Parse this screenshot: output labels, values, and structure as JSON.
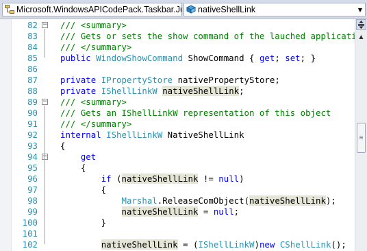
{
  "navbar": {
    "type_combo": {
      "label": "Microsoft.WindowsAPICodePack.Taskbar.Ju",
      "icon": "class-icon"
    },
    "member_combo": {
      "label": "nativeShellLink",
      "icon": "field-icon"
    }
  },
  "colors": {
    "keyword": "#0000ff",
    "comment": "#008000",
    "type": "#2b91af",
    "line_number": "#2b91af",
    "reference_highlight": "#e5e5d6"
  },
  "lines": [
    {
      "num": "82",
      "fold": "-",
      "segs": [
        {
          "t": "/// <summary>",
          "c": "c"
        }
      ]
    },
    {
      "num": "83",
      "segs": [
        {
          "t": "/// Gets or sets the show command of the lauched application.",
          "c": "c"
        }
      ]
    },
    {
      "num": "84",
      "segs": [
        {
          "t": "/// </summary>",
          "c": "c"
        }
      ]
    },
    {
      "num": "85",
      "segs": [
        {
          "t": "public ",
          "c": "k"
        },
        {
          "t": "WindowShowCommand",
          "c": "t"
        },
        {
          "t": " ShowCommand { "
        },
        {
          "t": "get",
          "c": "k"
        },
        {
          "t": "; "
        },
        {
          "t": "set",
          "c": "k"
        },
        {
          "t": "; }"
        }
      ]
    },
    {
      "num": "86",
      "segs": []
    },
    {
      "num": "87",
      "segs": [
        {
          "t": "private ",
          "c": "k"
        },
        {
          "t": "IPropertyStore",
          "c": "t"
        },
        {
          "t": " nativePropertyStore;"
        }
      ]
    },
    {
      "num": "88",
      "segs": [
        {
          "t": "private ",
          "c": "k"
        },
        {
          "t": "IShellLinkW",
          "c": "t"
        },
        {
          "t": " "
        },
        {
          "t": "nativeShellLink",
          "h": true
        },
        {
          "t": ";"
        }
      ]
    },
    {
      "num": "89",
      "fold": "-",
      "segs": [
        {
          "t": "/// <summary>",
          "c": "c"
        }
      ]
    },
    {
      "num": "90",
      "segs": [
        {
          "t": "/// Gets an IShellLinkW representation of this object",
          "c": "c"
        }
      ]
    },
    {
      "num": "91",
      "segs": [
        {
          "t": "/// </summary>",
          "c": "c"
        }
      ]
    },
    {
      "num": "92",
      "segs": [
        {
          "t": "internal ",
          "c": "k"
        },
        {
          "t": "IShellLinkW",
          "c": "t"
        },
        {
          "t": " NativeShellLink"
        }
      ]
    },
    {
      "num": "93",
      "segs": [
        {
          "t": "{"
        }
      ]
    },
    {
      "num": "94",
      "fold": "-",
      "segs": [
        {
          "t": "    "
        },
        {
          "t": "get",
          "c": "k"
        }
      ]
    },
    {
      "num": "95",
      "segs": [
        {
          "t": "    {"
        }
      ]
    },
    {
      "num": "96",
      "segs": [
        {
          "t": "        "
        },
        {
          "t": "if",
          "c": "k"
        },
        {
          "t": " ("
        },
        {
          "t": "nativeShellLink",
          "h": true
        },
        {
          "t": " != "
        },
        {
          "t": "null",
          "c": "k"
        },
        {
          "t": ")"
        }
      ]
    },
    {
      "num": "97",
      "segs": [
        {
          "t": "        {"
        }
      ]
    },
    {
      "num": "98",
      "segs": [
        {
          "t": "            "
        },
        {
          "t": "Marshal",
          "c": "t"
        },
        {
          "t": ".ReleaseComObject("
        },
        {
          "t": "nativeShellLink",
          "h": true
        },
        {
          "t": ");"
        }
      ]
    },
    {
      "num": "99",
      "segs": [
        {
          "t": "            "
        },
        {
          "t": "nativeShellLink",
          "h": true
        },
        {
          "t": " = "
        },
        {
          "t": "null",
          "c": "k"
        },
        {
          "t": ";"
        }
      ]
    },
    {
      "num": "100",
      "segs": [
        {
          "t": "        }"
        }
      ]
    },
    {
      "num": "101",
      "segs": []
    },
    {
      "num": "102",
      "segs": [
        {
          "t": "        "
        },
        {
          "t": "nativeShellLink",
          "h": true
        },
        {
          "t": " = ("
        },
        {
          "t": "IShellLinkW",
          "c": "t"
        },
        {
          "t": ")"
        },
        {
          "t": "new ",
          "c": "k"
        },
        {
          "t": "CShellLink",
          "c": "t"
        },
        {
          "t": "();"
        }
      ]
    }
  ],
  "scrollbar": {
    "position_fraction": 0.48
  }
}
